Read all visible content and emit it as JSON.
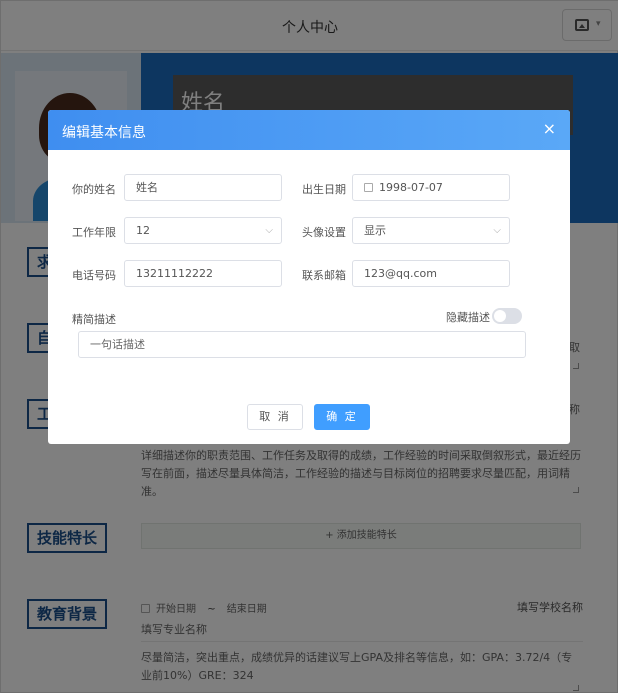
{
  "header": {
    "title": "个人中心"
  },
  "banner": {
    "name_placeholder": "姓名"
  },
  "sections": {
    "skills": "技能特长",
    "education": "教育背景",
    "partial_labels": [
      "求",
      "自",
      "工"
    ]
  },
  "background": {
    "truncated_right_1": "取",
    "truncated_right_2": "称",
    "work_desc": "详细描述你的职责范围、工作任务及取得的成绩，工作经验的时间采取倒叙形式，最近经历写在前面，描述尽量具体简洁，工作经验的描述与目标岗位的招聘要求尽量匹配，用词精准。",
    "add_skill": "+ 添加技能特长",
    "edu_start": "开始日期",
    "edu_tilde": "~",
    "edu_end": "结束日期",
    "edu_school": "填写学校名称",
    "edu_major": "填写专业名称",
    "edu_desc": "尽量简洁，突出重点，成绩优异的话建议写上GPA及排名等信息，如：GPA：3.72/4（专业前10%）GRE：324"
  },
  "modal": {
    "title": "编辑基本信息",
    "close": "×",
    "fields": {
      "name": {
        "label": "你的姓名",
        "value": "姓名"
      },
      "birth": {
        "label": "出生日期",
        "value": "1998-07-07"
      },
      "years": {
        "label": "工作年限",
        "value": "12"
      },
      "avatar_setting": {
        "label": "头像设置",
        "value": "显示"
      },
      "phone": {
        "label": "电话号码",
        "value": "13211112222"
      },
      "email": {
        "label": "联系邮箱",
        "value": "123@qq.com"
      },
      "brief": {
        "label": "精简描述",
        "placeholder": "一句话描述"
      },
      "hide_desc": {
        "label": "隐藏描述",
        "on": false
      }
    },
    "buttons": {
      "cancel": "取 消",
      "ok": "确 定"
    }
  }
}
